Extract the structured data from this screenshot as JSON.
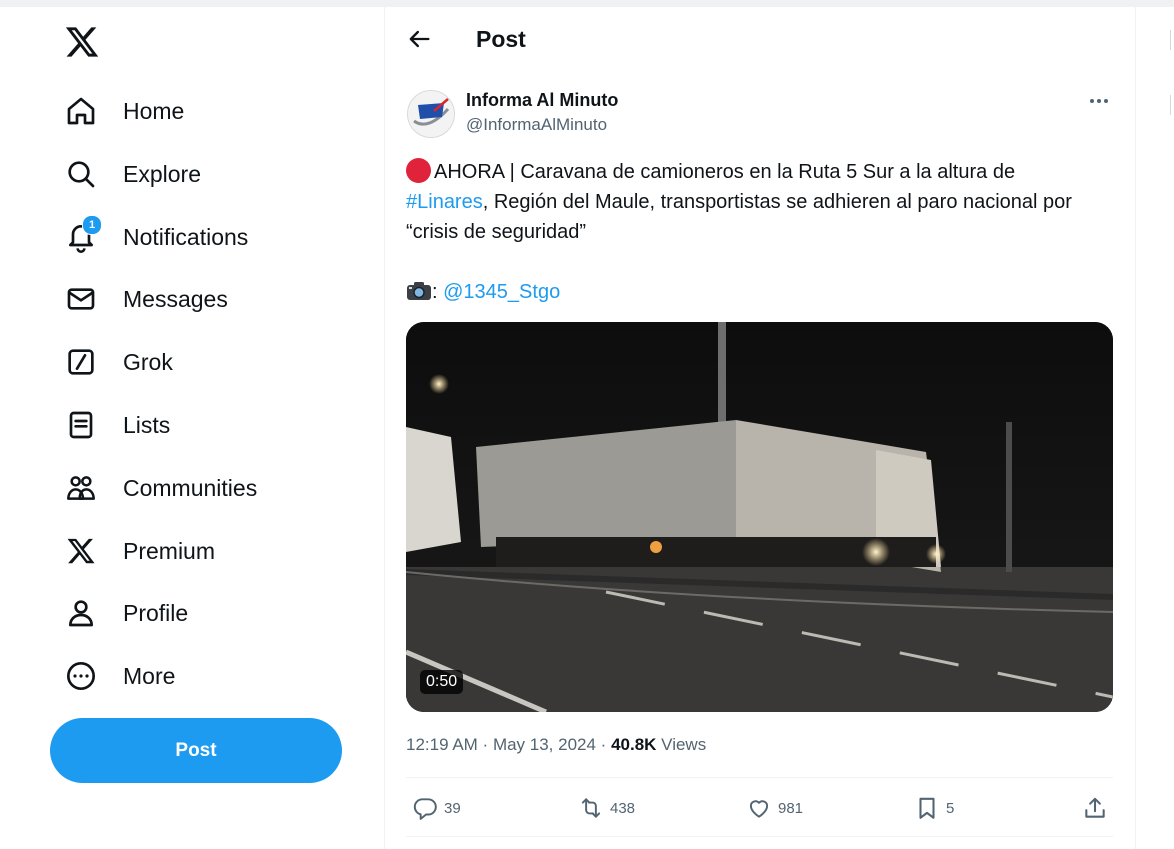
{
  "sidebar": {
    "items": [
      {
        "label": "Home",
        "icon": "home-icon"
      },
      {
        "label": "Explore",
        "icon": "search-icon"
      },
      {
        "label": "Notifications",
        "icon": "bell-icon",
        "badge": "1"
      },
      {
        "label": "Messages",
        "icon": "envelope-icon"
      },
      {
        "label": "Grok",
        "icon": "grok-icon"
      },
      {
        "label": "Lists",
        "icon": "list-icon"
      },
      {
        "label": "Communities",
        "icon": "communities-icon"
      },
      {
        "label": "Premium",
        "icon": "x-logo-icon"
      },
      {
        "label": "Profile",
        "icon": "person-icon"
      },
      {
        "label": "More",
        "icon": "more-circle-icon"
      }
    ],
    "post_button": "Post"
  },
  "header": {
    "title": "Post"
  },
  "post": {
    "author_name": "Informa Al Minuto",
    "author_handle": "@InformaAlMinuto",
    "text_line1": "AHORA | Caravana de camioneros en la Ruta 5 Sur a la altura de",
    "hashtag": "#Linares",
    "text_line2": ", Región del Maule, transportistas se adhieren al paro nacional por “crisis de seguridad”",
    "credit_prefix": ":",
    "credit_mention": "@1345_Stgo",
    "video_duration": "0:50",
    "time": "12:19 AM",
    "date": "May 13, 2024",
    "views_count": "40.8K",
    "views_label": "Views",
    "replies": "39",
    "reposts": "438",
    "likes": "981",
    "bookmarks": "5"
  },
  "colors": {
    "accent": "#1d9bf0",
    "text": "#0f1419",
    "muted": "#536471",
    "live_dot": "#e0223a"
  }
}
